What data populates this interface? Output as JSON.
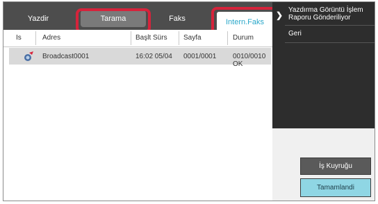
{
  "tabs": {
    "yazdir": "Yazdir",
    "tarama": "Tarama",
    "faks": "Faks",
    "intern_faks": "Intern.Faks"
  },
  "table": {
    "columns": [
      "Is",
      "Adres",
      "Başlt Sürs",
      "Sayfa",
      "Durum"
    ],
    "rows": [
      {
        "icon": "broadcast-icon",
        "adres": "Broadcast0001",
        "baslt_surs": "16:02 05/04",
        "sayfa": "0001/0001",
        "durum": "0010/0010 OK"
      }
    ]
  },
  "side_menu": {
    "item1": "Yazdırma Görüntü İşlem Raporu Gönderiliyor",
    "item2": "Geri"
  },
  "buttons": {
    "job_queue": "İş Kuyruğu",
    "done": "Tamamlandi"
  },
  "colors": {
    "highlight": "#d6233b",
    "active_tab_text": "#29a7c9",
    "done_button": "#8fd6e4"
  }
}
